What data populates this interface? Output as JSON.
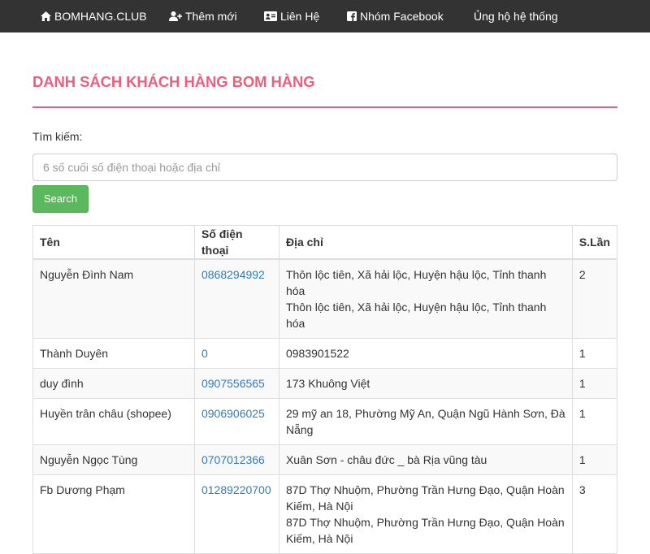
{
  "nav": {
    "brand": "BOMHANG.CLUB",
    "add_new": "Thêm mới",
    "contact": "Liên Hệ",
    "facebook_group": "Nhóm Facebook",
    "support": "Ủng hộ hệ thống"
  },
  "page_title": "DANH SÁCH KHÁCH HÀNG BOM HÀNG",
  "search": {
    "label": "Tìm kiếm:",
    "placeholder": "6 số cuối số điện thoại hoặc địa chỉ",
    "button": "Search"
  },
  "table": {
    "headers": [
      "Tên",
      "Số điện thoại",
      "Địa chỉ",
      "S.Lần"
    ],
    "rows": [
      {
        "name": "Nguyễn Đình Nam",
        "phone": "0868294992",
        "address": [
          "Thôn lộc tiên, Xã hải lộc, Huyện hậu lộc, Tỉnh thanh hóa",
          "Thôn lộc tiên, Xã hải lộc, Huyện hậu lộc, Tỉnh thanh hóa"
        ],
        "count": "2"
      },
      {
        "name": "Thành Duyên",
        "phone": "0",
        "address": [
          "0983901522"
        ],
        "count": "1"
      },
      {
        "name": "duy đình",
        "phone": "0907556565",
        "address": [
          "173 Khuông Việt"
        ],
        "count": "1"
      },
      {
        "name": "Huyền trân châu (shopee)",
        "phone": "0906906025",
        "address": [
          "29 mỹ an 18, Phường Mỹ An, Quận Ngũ Hành Sơn, Đà Nẵng"
        ],
        "count": "1"
      },
      {
        "name": "Nguyễn Ngọc Tùng",
        "phone": "0707012366",
        "address": [
          "Xuân Sơn - châu đức _ bà Rịa vũng tàu"
        ],
        "count": "1"
      },
      {
        "name": "Fb Dương Phạm",
        "phone": "01289220700",
        "address": [
          "87D Thợ Nhuộm, Phường Trần Hưng Đạo, Quận Hoàn Kiếm, Hà Nội",
          "87D Thợ Nhuộm, Phường Trần Hưng Đạo, Quận Hoàn Kiếm, Hà Nội"
        ],
        "count": "3"
      }
    ]
  }
}
